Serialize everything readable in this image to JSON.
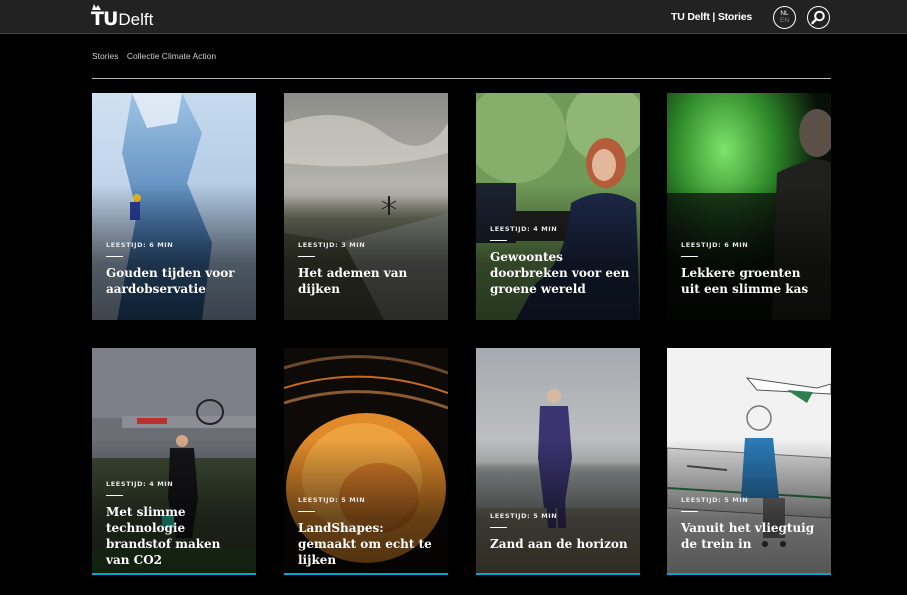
{
  "header": {
    "logo_tu": "TU",
    "logo_delft": "Delft",
    "site_name": "TU Delft | Stories",
    "lang_active": "NL",
    "lang_other": "EN",
    "search_icon": "search-icon"
  },
  "breadcrumb": [
    "Stories",
    "Collectie Climate Action"
  ],
  "cards": [
    {
      "meta": "LEESTIJD: 6 MIN",
      "title": "Gouden tijden voor aardobservatie",
      "image": "ice-cave-climber"
    },
    {
      "meta": "LEESTIJD: 3 MIN",
      "title": "Het ademen van dijken",
      "image": "dike-windmill"
    },
    {
      "meta": "LEESTIJD: 4 MIN",
      "title": "Gewoontes doorbreken voor een groene wereld",
      "image": "woman-at-desk-garden"
    },
    {
      "meta": "LEESTIJD: 6 MIN",
      "title": "Lekkere groenten uit een slimme kas",
      "image": "man-green-greenhouse"
    },
    {
      "meta": "LEESTIJD: 4 MIN",
      "title": "Met slimme technologie brandstof maken van CO2",
      "image": "man-at-gas-station"
    },
    {
      "meta": "LEESTIJD: 5 MIN",
      "title": "LandShapes: gemaakt om echt te lijken",
      "image": "orange-landscape-porthole"
    },
    {
      "meta": "LEESTIJD: 5 MIN",
      "title": "Zand aan de horizon",
      "image": "man-on-beach"
    },
    {
      "meta": "LEESTIJD: 5 MIN",
      "title": "Vanuit het vliegtuig de trein in",
      "image": "illustration-plane-train"
    }
  ],
  "colors": {
    "accent": "#00a6d6",
    "topbar": "#222222",
    "background": "#000000"
  }
}
